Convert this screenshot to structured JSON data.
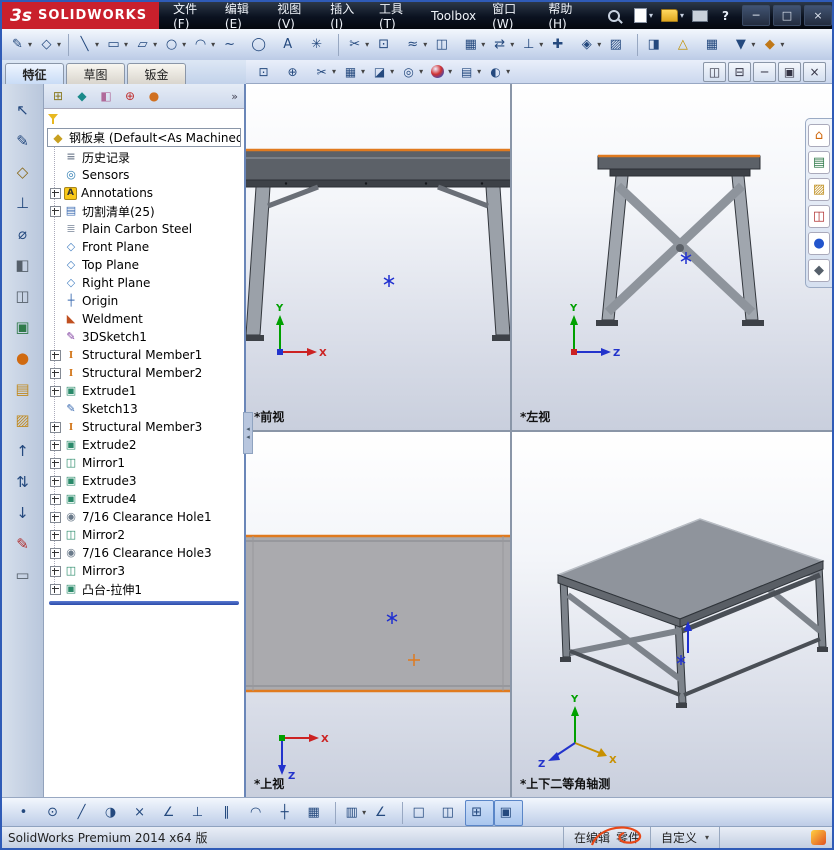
{
  "colors": {
    "logo_red": "#c9202c",
    "edge_orange": "#e07a1f",
    "origin_blue": "#2030d0",
    "axis_x": "#cc2222",
    "axis_y": "#00a000",
    "axis_z": "#2233cc",
    "rollback_blue": "#2a4aaa"
  },
  "titlebar": {
    "logo_mark": "3s",
    "logo_text": "SOLIDWORKS",
    "menus": [
      {
        "name": "menu-file",
        "label": "文件(F)"
      },
      {
        "name": "menu-edit",
        "label": "编辑(E)"
      },
      {
        "name": "menu-view",
        "label": "视图(V)"
      },
      {
        "name": "menu-insert",
        "label": "插入(I)"
      },
      {
        "name": "menu-tools",
        "label": "工具(T)"
      },
      {
        "name": "menu-toolbox",
        "label": "Toolbox"
      },
      {
        "name": "menu-window",
        "label": "窗口(W)"
      },
      {
        "name": "menu-help",
        "label": "帮助(H)"
      }
    ],
    "quick_icons": [
      {
        "name": "new-document-button",
        "icon": "page",
        "dd": true
      },
      {
        "name": "open-document-button",
        "icon": "folder",
        "dd": true
      },
      {
        "name": "print-button",
        "icon": "printer",
        "dd": false
      },
      {
        "name": "help-button",
        "icon": "help",
        "dd": false
      }
    ],
    "window_buttons": [
      {
        "name": "minimize-button",
        "glyph": "─"
      },
      {
        "name": "maximize-button",
        "glyph": "□"
      },
      {
        "name": "close-button",
        "glyph": "×"
      }
    ]
  },
  "toolbar_sketch": {
    "group_a": [
      {
        "name": "sketch-button",
        "glyph": "✎",
        "dd": true
      },
      {
        "name": "smart-dimension-button",
        "glyph": "◇",
        "dd": true
      }
    ],
    "group_b": [
      {
        "name": "line-button",
        "glyph": "╲",
        "dd": true
      },
      {
        "name": "rectangle-button",
        "glyph": "▭",
        "dd": true
      },
      {
        "name": "slot-button",
        "glyph": "▱",
        "dd": true
      },
      {
        "name": "circle-button",
        "glyph": "○",
        "dd": true
      },
      {
        "name": "arc-button",
        "glyph": "◠",
        "dd": true
      },
      {
        "name": "spline-button",
        "glyph": "~"
      },
      {
        "name": "ellipse-button",
        "glyph": "◯"
      },
      {
        "name": "sketch-text-button",
        "glyph": "A"
      },
      {
        "name": "point-button",
        "glyph": "✳"
      }
    ],
    "group_c": [
      {
        "name": "trim-entities-button",
        "glyph": "✂",
        "dd": true
      },
      {
        "name": "convert-entities-button",
        "glyph": "⊡"
      },
      {
        "name": "offset-entities-button",
        "glyph": "≈",
        "dd": true
      },
      {
        "name": "mirror-entities-button",
        "glyph": "◫"
      },
      {
        "name": "linear-pattern-button",
        "glyph": "▦",
        "dd": true
      },
      {
        "name": "move-entities-button",
        "glyph": "⇄",
        "dd": true
      },
      {
        "name": "display-relations-button",
        "glyph": "⊥",
        "dd": true
      },
      {
        "name": "repair-sketch-button",
        "glyph": "✚"
      },
      {
        "name": "quick-snaps-button",
        "glyph": "◈",
        "dd": true
      },
      {
        "name": "rapid-sketch-button",
        "glyph": "▨"
      }
    ],
    "group_d": [
      {
        "name": "instant2d-button",
        "glyph": "◨"
      },
      {
        "name": "sketch-alert-button",
        "glyph": "△",
        "color": "#c09000"
      },
      {
        "name": "grid-system-button",
        "glyph": "▦"
      },
      {
        "name": "selection-filter-button",
        "glyph": "▼",
        "dd": true
      },
      {
        "name": "customize-button",
        "glyph": "◆",
        "color": "#c07818",
        "dd": true
      }
    ]
  },
  "command_tabs": {
    "items": [
      {
        "name": "tab-features",
        "label": "特征",
        "pressed": true
      },
      {
        "name": "tab-sketch",
        "label": "草图"
      },
      {
        "name": "tab-sheet-metal",
        "label": "钣金"
      }
    ]
  },
  "graphics_toolbar": {
    "icons": [
      {
        "name": "zoom-fit-button",
        "glyph": "⊡"
      },
      {
        "name": "zoom-area-button",
        "glyph": "⊕"
      },
      {
        "name": "section-view-button",
        "glyph": "✂",
        "dd": true
      },
      {
        "name": "view-orientation-button",
        "glyph": "▦",
        "dd": true
      },
      {
        "name": "display-style-button",
        "glyph": "◪",
        "dd": true
      },
      {
        "name": "hide-show-items-button",
        "glyph": "◎",
        "dd": true
      },
      {
        "name": "edit-appearance-button",
        "icon": "ball",
        "dd": true
      },
      {
        "name": "apply-scene-button",
        "glyph": "▤",
        "dd": true
      },
      {
        "name": "view-settings-button",
        "glyph": "◐",
        "dd": true
      }
    ],
    "window_buttons": [
      {
        "name": "split-pane-button",
        "glyph": "◫"
      },
      {
        "name": "tile-pane-button",
        "glyph": "⊟"
      },
      {
        "name": "child-minimize-button",
        "glyph": "─"
      },
      {
        "name": "child-restore-button",
        "glyph": "▣"
      },
      {
        "name": "child-close-button",
        "glyph": "×"
      }
    ]
  },
  "left_toolbar": {
    "items": [
      {
        "name": "select-tool-button",
        "glyph": "↖",
        "color": "#24497e"
      },
      {
        "name": "sketch-tool-button",
        "glyph": "✎",
        "color": "#24497e"
      },
      {
        "name": "dimension-tool-button",
        "glyph": "◇",
        "color": "#8a6a1a"
      },
      {
        "name": "relation-tool-button",
        "glyph": "⊥",
        "color": "#24497e"
      },
      {
        "name": "measure-tool-button",
        "glyph": "⌀",
        "color": "#24497e"
      },
      {
        "name": "section-tool-button",
        "glyph": "◧",
        "color": "#555f6a"
      },
      {
        "name": "wireframe-tool-button",
        "glyph": "◫",
        "color": "#555f6a"
      },
      {
        "name": "shaded-tool-button",
        "glyph": "▣",
        "color": "#2f7a4a"
      },
      {
        "name": "appearance-tool-button",
        "glyph": "●",
        "color": "#d06a10"
      },
      {
        "name": "scene-tool-button",
        "glyph": "▤",
        "color": "#c08a20"
      },
      {
        "name": "texture-tool-button",
        "glyph": "▨",
        "color": "#c08a20"
      },
      {
        "name": "move-up-button",
        "glyph": "↑",
        "color": "#24497e"
      },
      {
        "name": "reorder-button",
        "glyph": "⇅",
        "color": "#24497e"
      },
      {
        "name": "move-down-button",
        "glyph": "↓",
        "color": "#24497e"
      },
      {
        "name": "annotate-pen-button",
        "glyph": "✎",
        "color": "#b03030"
      },
      {
        "name": "erase-mark-button",
        "glyph": "▭",
        "color": "#555f6a"
      }
    ]
  },
  "task_pane": {
    "items": [
      {
        "name": "resources-tab",
        "glyph": "⌂",
        "color": "#d06a10"
      },
      {
        "name": "design-library-tab",
        "glyph": "▤",
        "color": "#2f7a4a"
      },
      {
        "name": "file-explorer-tab",
        "glyph": "▨",
        "color": "#c09020"
      },
      {
        "name": "view-palette-tab",
        "glyph": "◫",
        "color": "#b03030"
      },
      {
        "name": "appearances-tab",
        "glyph": "●",
        "color": "#2255cc"
      },
      {
        "name": "custom-properties-tab",
        "glyph": "◆",
        "color": "#555f6a"
      }
    ]
  },
  "feature_tree": {
    "manager_tabs": [
      {
        "name": "featuremanager-tab",
        "glyph": "⊞",
        "color": "#8a7a20"
      },
      {
        "name": "propertymanager-tab",
        "glyph": "◆",
        "color": "#1a8a8a"
      },
      {
        "name": "configurationmanager-tab",
        "glyph": "◧",
        "color": "#b06a9a"
      },
      {
        "name": "dimxpertmanager-tab",
        "glyph": "⊕",
        "color": "#c03030"
      },
      {
        "name": "displaymanager-tab",
        "glyph": "●",
        "color": "#d07020"
      }
    ],
    "overflow_chevron": "»",
    "root_label": "钢板桌 (Default<As Machined>",
    "items": [
      {
        "label": "历史记录",
        "icon": "history",
        "expand": false
      },
      {
        "label": "Sensors",
        "icon": "sensors",
        "expand": false
      },
      {
        "label": "Annotations",
        "icon": "annotations",
        "expand": true
      },
      {
        "label": "切割清单(25)",
        "icon": "cutlist",
        "expand": true
      },
      {
        "label": "Plain Carbon Steel",
        "icon": "material",
        "expand": false
      },
      {
        "label": "Front Plane",
        "icon": "plane",
        "expand": false
      },
      {
        "label": "Top Plane",
        "icon": "plane",
        "expand": false
      },
      {
        "label": "Right Plane",
        "icon": "plane",
        "expand": false
      },
      {
        "label": "Origin",
        "icon": "origin",
        "expand": false
      },
      {
        "label": "Weldment",
        "icon": "weldment",
        "expand": false
      },
      {
        "label": "3DSketch1",
        "icon": "sketch3d",
        "expand": false
      },
      {
        "label": "Structural Member1",
        "icon": "structural",
        "expand": true
      },
      {
        "label": "Structural Member2",
        "icon": "structural",
        "expand": true
      },
      {
        "label": "Extrude1",
        "icon": "extrude",
        "expand": true
      },
      {
        "label": "Sketch13",
        "icon": "sketch",
        "expand": false
      },
      {
        "label": "Structural Member3",
        "icon": "structural",
        "expand": true
      },
      {
        "label": "Extrude2",
        "icon": "extrude",
        "expand": true
      },
      {
        "label": "Mirror1",
        "icon": "mirror",
        "expand": true
      },
      {
        "label": "Extrude3",
        "icon": "extrude",
        "expand": true
      },
      {
        "label": "Extrude4",
        "icon": "extrude",
        "expand": true
      },
      {
        "label": "7/16 Clearance Hole1",
        "icon": "hole",
        "expand": true
      },
      {
        "label": "Mirror2",
        "icon": "mirror",
        "expand": true
      },
      {
        "label": "7/16 Clearance Hole3",
        "icon": "hole",
        "expand": true
      },
      {
        "label": "Mirror3",
        "icon": "mirror",
        "expand": true
      },
      {
        "label": "凸台-拉伸1",
        "icon": "boss",
        "expand": true
      }
    ]
  },
  "viewports": [
    {
      "name": "viewport-front",
      "label": "*前视"
    },
    {
      "name": "viewport-left",
      "label": "*左视"
    },
    {
      "name": "viewport-top",
      "label": "*上视"
    },
    {
      "name": "viewport-isometric",
      "label": "*上下二等角轴测"
    }
  ],
  "bottom_toolbar": {
    "snap_icons": [
      {
        "name": "snap-point-button",
        "glyph": "•"
      },
      {
        "name": "snap-center-button",
        "glyph": "⊙"
      },
      {
        "name": "snap-line-button",
        "glyph": "╱"
      },
      {
        "name": "snap-quadrant-button",
        "glyph": "◑"
      },
      {
        "name": "snap-intersection-button",
        "glyph": "×"
      },
      {
        "name": "snap-angle-button",
        "glyph": "∠"
      },
      {
        "name": "snap-perpendicular-button",
        "glyph": "⊥"
      },
      {
        "name": "snap-parallel-button",
        "glyph": "∥"
      },
      {
        "name": "snap-tangent-button",
        "glyph": "◠"
      },
      {
        "name": "snap-midpoint-button",
        "glyph": "┼"
      },
      {
        "name": "snap-grid-button",
        "glyph": "▦"
      }
    ],
    "settings_icons": [
      {
        "name": "grid-settings-button",
        "glyph": "▥",
        "dd": true
      },
      {
        "name": "angle-snap-button",
        "glyph": "∠"
      }
    ],
    "view_icons": [
      {
        "name": "single-view-button",
        "glyph": "□"
      },
      {
        "name": "two-view-button",
        "glyph": "◫"
      },
      {
        "name": "four-view-button",
        "glyph": "⊞",
        "pressed": true
      },
      {
        "name": "linked-views-button",
        "glyph": "▣",
        "pressed": true
      }
    ]
  },
  "statusbar": {
    "product": "SolidWorks Premium 2014 x64 版",
    "editing_label": "在编辑",
    "doc_label": "零件",
    "custom_label": "自定义"
  }
}
